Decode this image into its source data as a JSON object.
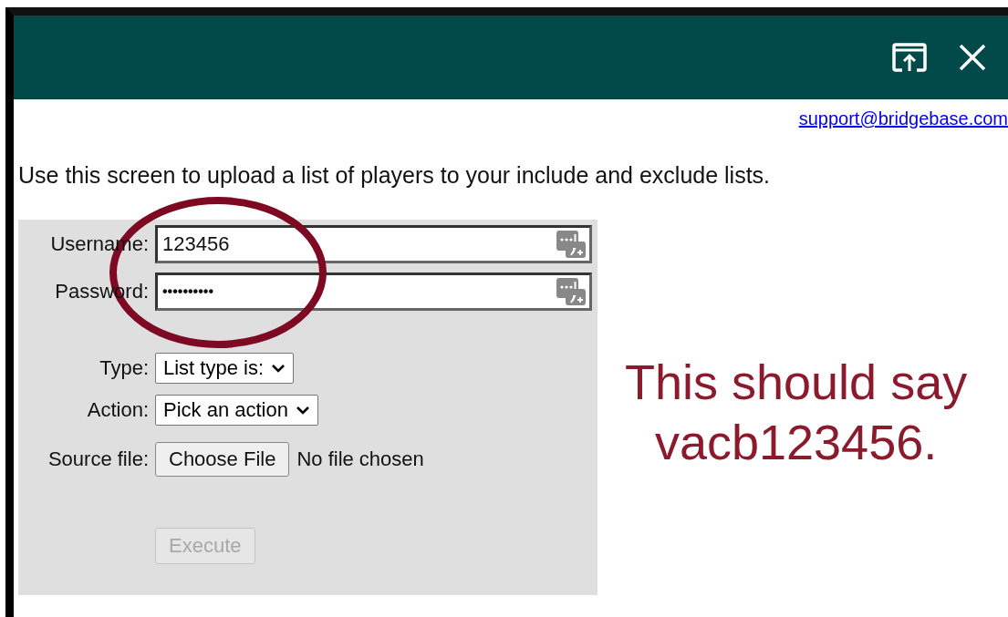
{
  "support_link": "support@bridgebase.com",
  "intro": "Use this screen to upload a list of players to your include and exclude lists.",
  "form": {
    "fields": [
      {
        "label": "Username:",
        "value": "123456",
        "kind": "text"
      },
      {
        "label": "Password:",
        "value": "••••••••••",
        "kind": "password"
      }
    ],
    "selects": [
      {
        "label": "Type:",
        "value": "List type is:"
      },
      {
        "label": "Action:",
        "value": "Pick an action"
      }
    ],
    "file": {
      "label": "Source file:",
      "button": "Choose File",
      "status": "No file chosen"
    },
    "execute": {
      "label": "Execute",
      "disabled": true
    }
  },
  "annotation": {
    "lines": [
      "This should say",
      "vacb123456."
    ]
  }
}
